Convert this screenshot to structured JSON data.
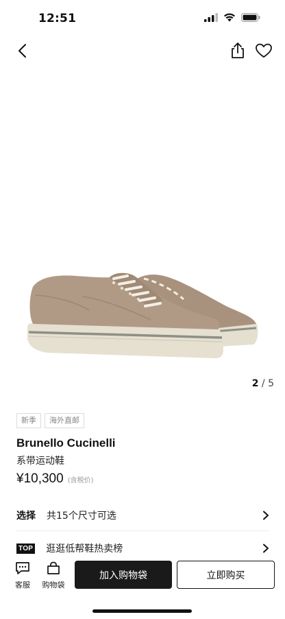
{
  "status": {
    "time": "12:51"
  },
  "gallery": {
    "current": "2",
    "separator": "/",
    "total": "5"
  },
  "tags": [
    "新季",
    "海外直邮"
  ],
  "product": {
    "brand": "Brunello Cucinelli",
    "name": "系带运动鞋",
    "price": "¥10,300",
    "price_note": "(含税价)"
  },
  "size_row": {
    "label": "选择",
    "text": "共15个尺寸可选"
  },
  "top_row": {
    "badge": "TOP",
    "text": "逛逛低帮鞋热卖榜"
  },
  "bottom_bar": {
    "service_label": "客服",
    "bag_label": "购物袋",
    "add_to_bag": "加入购物袋",
    "buy_now": "立即购买"
  },
  "colors": {
    "accent": "#1a1a1a",
    "tag_border": "#dcdcdc",
    "shoe_suede": "#b09a85"
  }
}
